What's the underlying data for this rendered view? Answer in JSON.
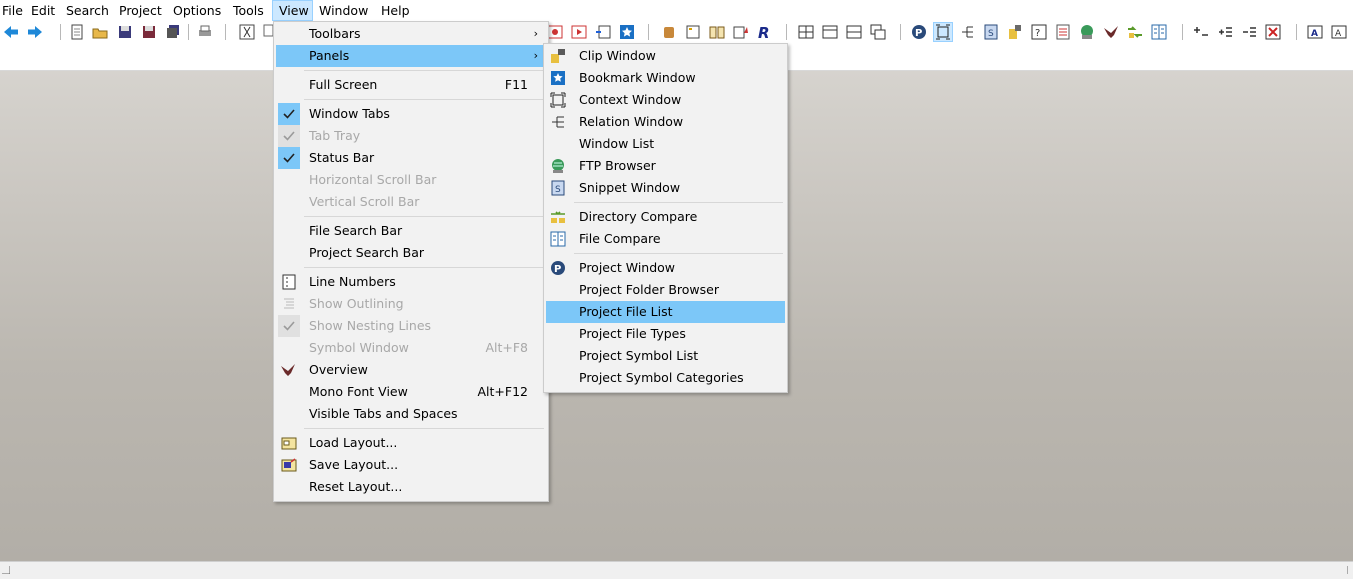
{
  "menubar": {
    "items": [
      "File",
      "Edit",
      "Search",
      "Project",
      "Options",
      "Tools",
      "View",
      "Window",
      "Help"
    ],
    "active": "View"
  },
  "view_menu": {
    "items": [
      {
        "label": "Toolbars",
        "submenu": true
      },
      {
        "label": "Panels",
        "submenu": true,
        "highlighted": true
      },
      {
        "label": "Full Screen",
        "shortcut": "F11"
      },
      {
        "label": "Window Tabs",
        "checked": true
      },
      {
        "label": "Tab Tray",
        "checked": true,
        "disabled": true
      },
      {
        "label": "Status Bar",
        "checked": true
      },
      {
        "label": "Horizontal Scroll Bar",
        "disabled": true
      },
      {
        "label": "Vertical Scroll Bar",
        "disabled": true
      },
      {
        "label": "File Search Bar"
      },
      {
        "label": "Project Search Bar"
      },
      {
        "label": "Line Numbers",
        "icon": "line-numbers-icon"
      },
      {
        "label": "Show Outlining",
        "disabled": true,
        "icon": "outlining-icon"
      },
      {
        "label": "Show Nesting Lines",
        "checked": true,
        "disabled": true
      },
      {
        "label": "Symbol Window",
        "shortcut": "Alt+F8",
        "disabled": true
      },
      {
        "label": "Overview",
        "icon": "bird-icon"
      },
      {
        "label": "Mono Font View",
        "shortcut": "Alt+F12"
      },
      {
        "label": "Visible Tabs and Spaces"
      },
      {
        "label": "Load Layout...",
        "icon": "load-layout-icon"
      },
      {
        "label": "Save Layout...",
        "icon": "save-layout-icon"
      },
      {
        "label": "Reset Layout..."
      }
    ]
  },
  "panels_menu": {
    "items": [
      {
        "label": "Clip Window",
        "icon": "clip-window-icon"
      },
      {
        "label": "Bookmark Window",
        "icon": "bookmark-icon"
      },
      {
        "label": "Context Window",
        "icon": "context-window-icon"
      },
      {
        "label": "Relation Window",
        "icon": "relation-window-icon"
      },
      {
        "label": "Window List"
      },
      {
        "label": "FTP Browser",
        "icon": "ftp-globe-icon"
      },
      {
        "label": "Snippet Window",
        "icon": "snippet-icon"
      },
      {
        "label": "Directory Compare",
        "icon": "directory-compare-icon"
      },
      {
        "label": "File Compare",
        "icon": "file-compare-icon"
      },
      {
        "label": "Project Window",
        "icon": "project-window-icon"
      },
      {
        "label": "Project Folder Browser"
      },
      {
        "label": "Project File List",
        "highlighted": true
      },
      {
        "label": "Project File Types"
      },
      {
        "label": "Project Symbol List"
      },
      {
        "label": "Project Symbol Categories"
      }
    ]
  },
  "colors": {
    "highlight": "#7cc7f8",
    "menu_bg": "#f2f2f2",
    "active_menubar": "#cce8ff",
    "workspace": "#bbb7b0"
  }
}
